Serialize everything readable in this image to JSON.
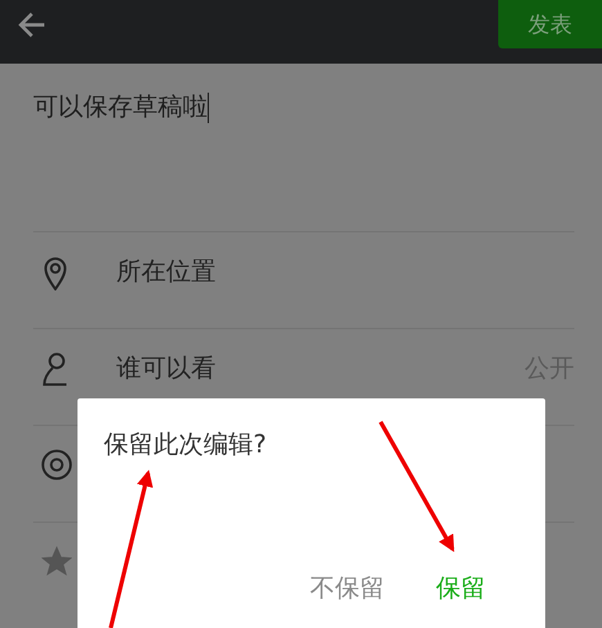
{
  "header": {
    "post_button": "发表"
  },
  "draft": {
    "value": "可以保存草稿啦"
  },
  "rows": [
    {
      "label": "所在位置"
    },
    {
      "label": "谁可以看",
      "value": "公开"
    }
  ],
  "dialog": {
    "message": "保留此次编辑?",
    "buttons": [
      {
        "label": "不保留",
        "kind": "secondary"
      },
      {
        "label": "保留",
        "kind": "primary"
      }
    ]
  }
}
